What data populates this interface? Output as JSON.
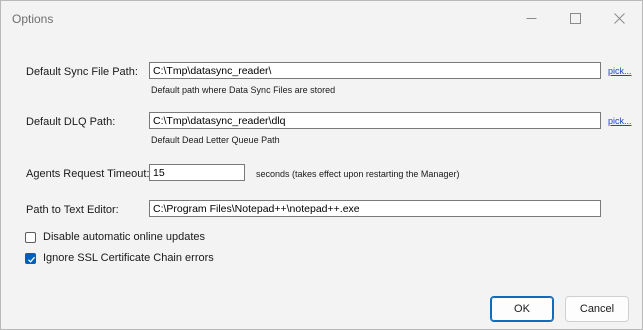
{
  "window": {
    "title": "Options"
  },
  "sync_path": {
    "label": "Default Sync File Path:",
    "value": "C:\\Tmp\\datasync_reader\\",
    "hint": "Default path where Data Sync Files are stored",
    "pick": "pick..."
  },
  "dlq_path": {
    "label": "Default DLQ Path:",
    "value": "C:\\Tmp\\datasync_reader\\dlq",
    "hint": "Default Dead Letter Queue Path",
    "pick": "pick..."
  },
  "timeout": {
    "label": "Agents Request Timeout:",
    "value": "15",
    "suffix": "seconds (takes effect upon restarting the Manager)"
  },
  "editor": {
    "label": "Path to Text Editor:",
    "value": "C:\\Program Files\\Notepad++\\notepad++.exe"
  },
  "options": {
    "disable_updates": {
      "label": "Disable automatic online updates",
      "checked": false
    },
    "ignore_ssl": {
      "label": "Ignore SSL Certificate Chain errors",
      "checked": true
    }
  },
  "buttons": {
    "ok": "OK",
    "cancel": "Cancel"
  },
  "colors": {
    "accent": "#005fb8",
    "link": "#1a46c8",
    "window_bg": "#f3f3f3"
  }
}
